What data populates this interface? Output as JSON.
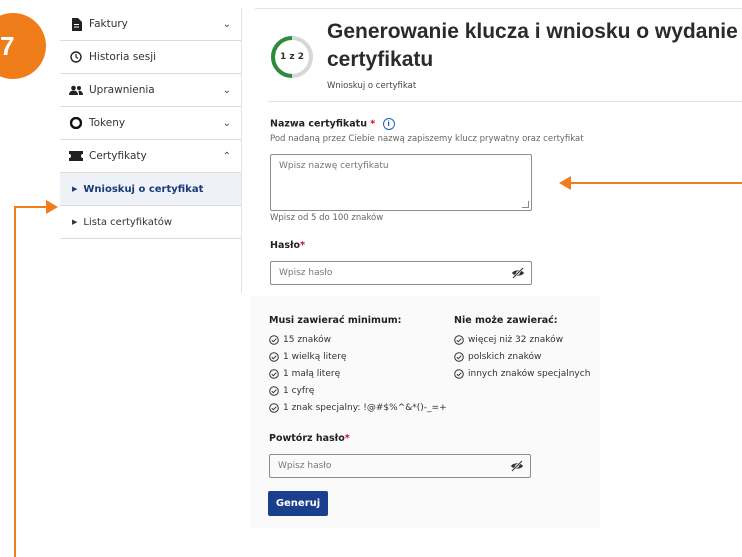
{
  "step_badge": "7",
  "sidebar": {
    "items": [
      {
        "label": "Faktury",
        "icon": "document-icon",
        "chevron": "⌄"
      },
      {
        "label": "Historia sesji",
        "icon": "clock-icon",
        "chevron": ""
      },
      {
        "label": "Uprawnienia",
        "icon": "users-icon",
        "chevron": "⌄"
      },
      {
        "label": "Tokeny",
        "icon": "token-icon",
        "chevron": "⌄"
      },
      {
        "label": "Certyfikaty",
        "icon": "ticket-icon",
        "chevron": "⌃"
      }
    ],
    "subitems": [
      {
        "label": "Wnioskuj o certyfikat",
        "active": true
      },
      {
        "label": "Lista certyfikatów",
        "active": false
      }
    ]
  },
  "header": {
    "progress": "1 z 2",
    "progress_fraction": 0.5,
    "title": "Generowanie klucza i wniosku o wydanie certyfikatu",
    "subtitle": "Wnioskuj o certyfikat"
  },
  "form": {
    "cert_name": {
      "label": "Nazwa certyfikatu",
      "required_mark": "*",
      "info_icon": "i",
      "help": "Pod nadaną przez Ciebie nazwą zapiszemy klucz prywatny oraz certyfikat",
      "placeholder": "Wpisz nazwę certyfikatu",
      "hint": "Wpisz od 5 do 100 znaków"
    },
    "password": {
      "label": "Hasło",
      "required_mark": "*",
      "placeholder": "Wpisz hasło"
    },
    "rules": {
      "must_title": "Musi zawierać minimum:",
      "must": [
        "15 znaków",
        "1 wielką literę",
        "1 małą literę",
        "1 cyfrę",
        "1 znak specjalny: !@#$%^&*()-_=+"
      ],
      "cannot_title": "Nie może zawierać:",
      "cannot": [
        "więcej niż 32 znaków",
        "polskich znaków",
        "innych znaków specjalnych"
      ]
    },
    "repeat_password": {
      "label": "Powtórz hasło",
      "required_mark": "*",
      "placeholder": "Wpisz hasło"
    },
    "submit_label": "Generuj"
  },
  "colors": {
    "accent_orange": "#ef7d1a",
    "primary_blue": "#1a3f8c",
    "progress_green": "#2e8b3a"
  }
}
